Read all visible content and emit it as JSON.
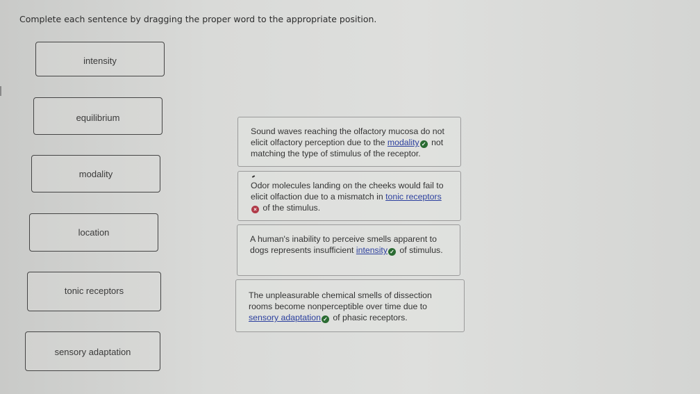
{
  "instructions": "Complete each sentence by dragging the proper word to the appropriate position.",
  "word_bank": [
    {
      "label": "intensity"
    },
    {
      "label": "equilibrium"
    },
    {
      "label": "modality"
    },
    {
      "label": "location"
    },
    {
      "label": "tonic receptors"
    },
    {
      "label": "sensory adaptation"
    }
  ],
  "sentences": [
    {
      "before": "Sound waves reaching the olfactory mucosa do not elicit olfactory perception due to the ",
      "answer": "modality",
      "status": "correct",
      "after": " not matching the type of stimulus of the receptor."
    },
    {
      "before": "Odor molecules landing on the cheeks would fail to elicit olfaction due to a mismatch in ",
      "answer": "tonic receptors",
      "status": "incorrect",
      "after": " of the stimulus."
    },
    {
      "before": "A human's inability to perceive smells apparent to dogs represents insufficient ",
      "answer": "intensity",
      "status": "correct",
      "after": " of stimulus."
    },
    {
      "before": "The unpleasurable chemical smells of dissection rooms become nonperceptible over time due to ",
      "answer": "sensory adaptation",
      "status": "correct",
      "after": " of phasic receptors."
    }
  ],
  "icons": {
    "correct": "check-circle-icon",
    "incorrect": "x-circle-icon"
  },
  "colors": {
    "answer_link": "#2b3f9e",
    "correct": "#2a6b32",
    "incorrect": "#b03a48"
  }
}
